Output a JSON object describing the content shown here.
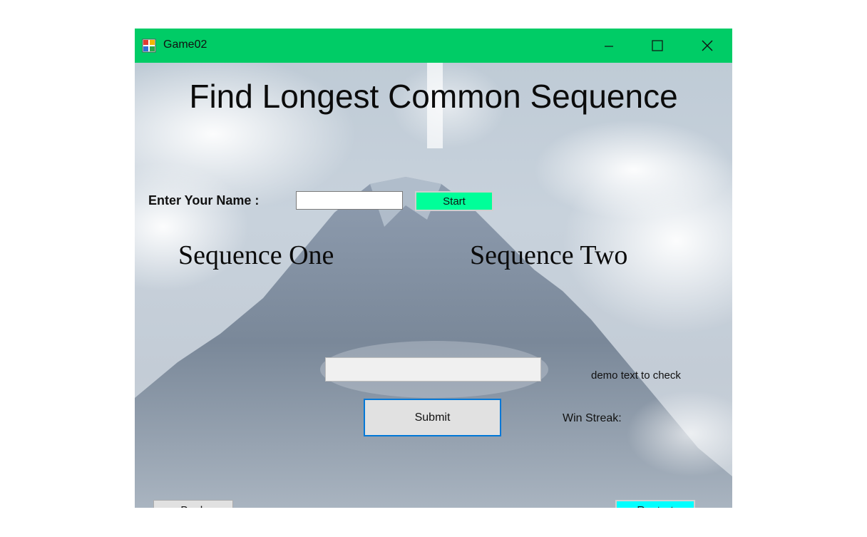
{
  "window": {
    "title": "Game02",
    "titlebar_color": "#00cc66",
    "controls": {
      "minimize_icon": "minimize-icon",
      "maximize_icon": "maximize-icon",
      "close_icon": "close-icon"
    }
  },
  "main": {
    "heading": "Find Longest Common Sequence",
    "name_label": "Enter Your Name :",
    "name_input": {
      "value": "",
      "placeholder": ""
    },
    "start_label": "Start",
    "sequence_one_label": "Sequence One",
    "sequence_two_label": "Sequence Two",
    "answer_input": {
      "value": "",
      "placeholder": ""
    },
    "demo_text": "demo text to check",
    "submit_label": "Submit",
    "win_streak_label": "Win Streak:",
    "back_label": "Back",
    "restart_label": "Restart"
  },
  "colors": {
    "start_button": "#00ff99",
    "restart_button": "#00ffff",
    "submit_border": "#0078d7"
  }
}
